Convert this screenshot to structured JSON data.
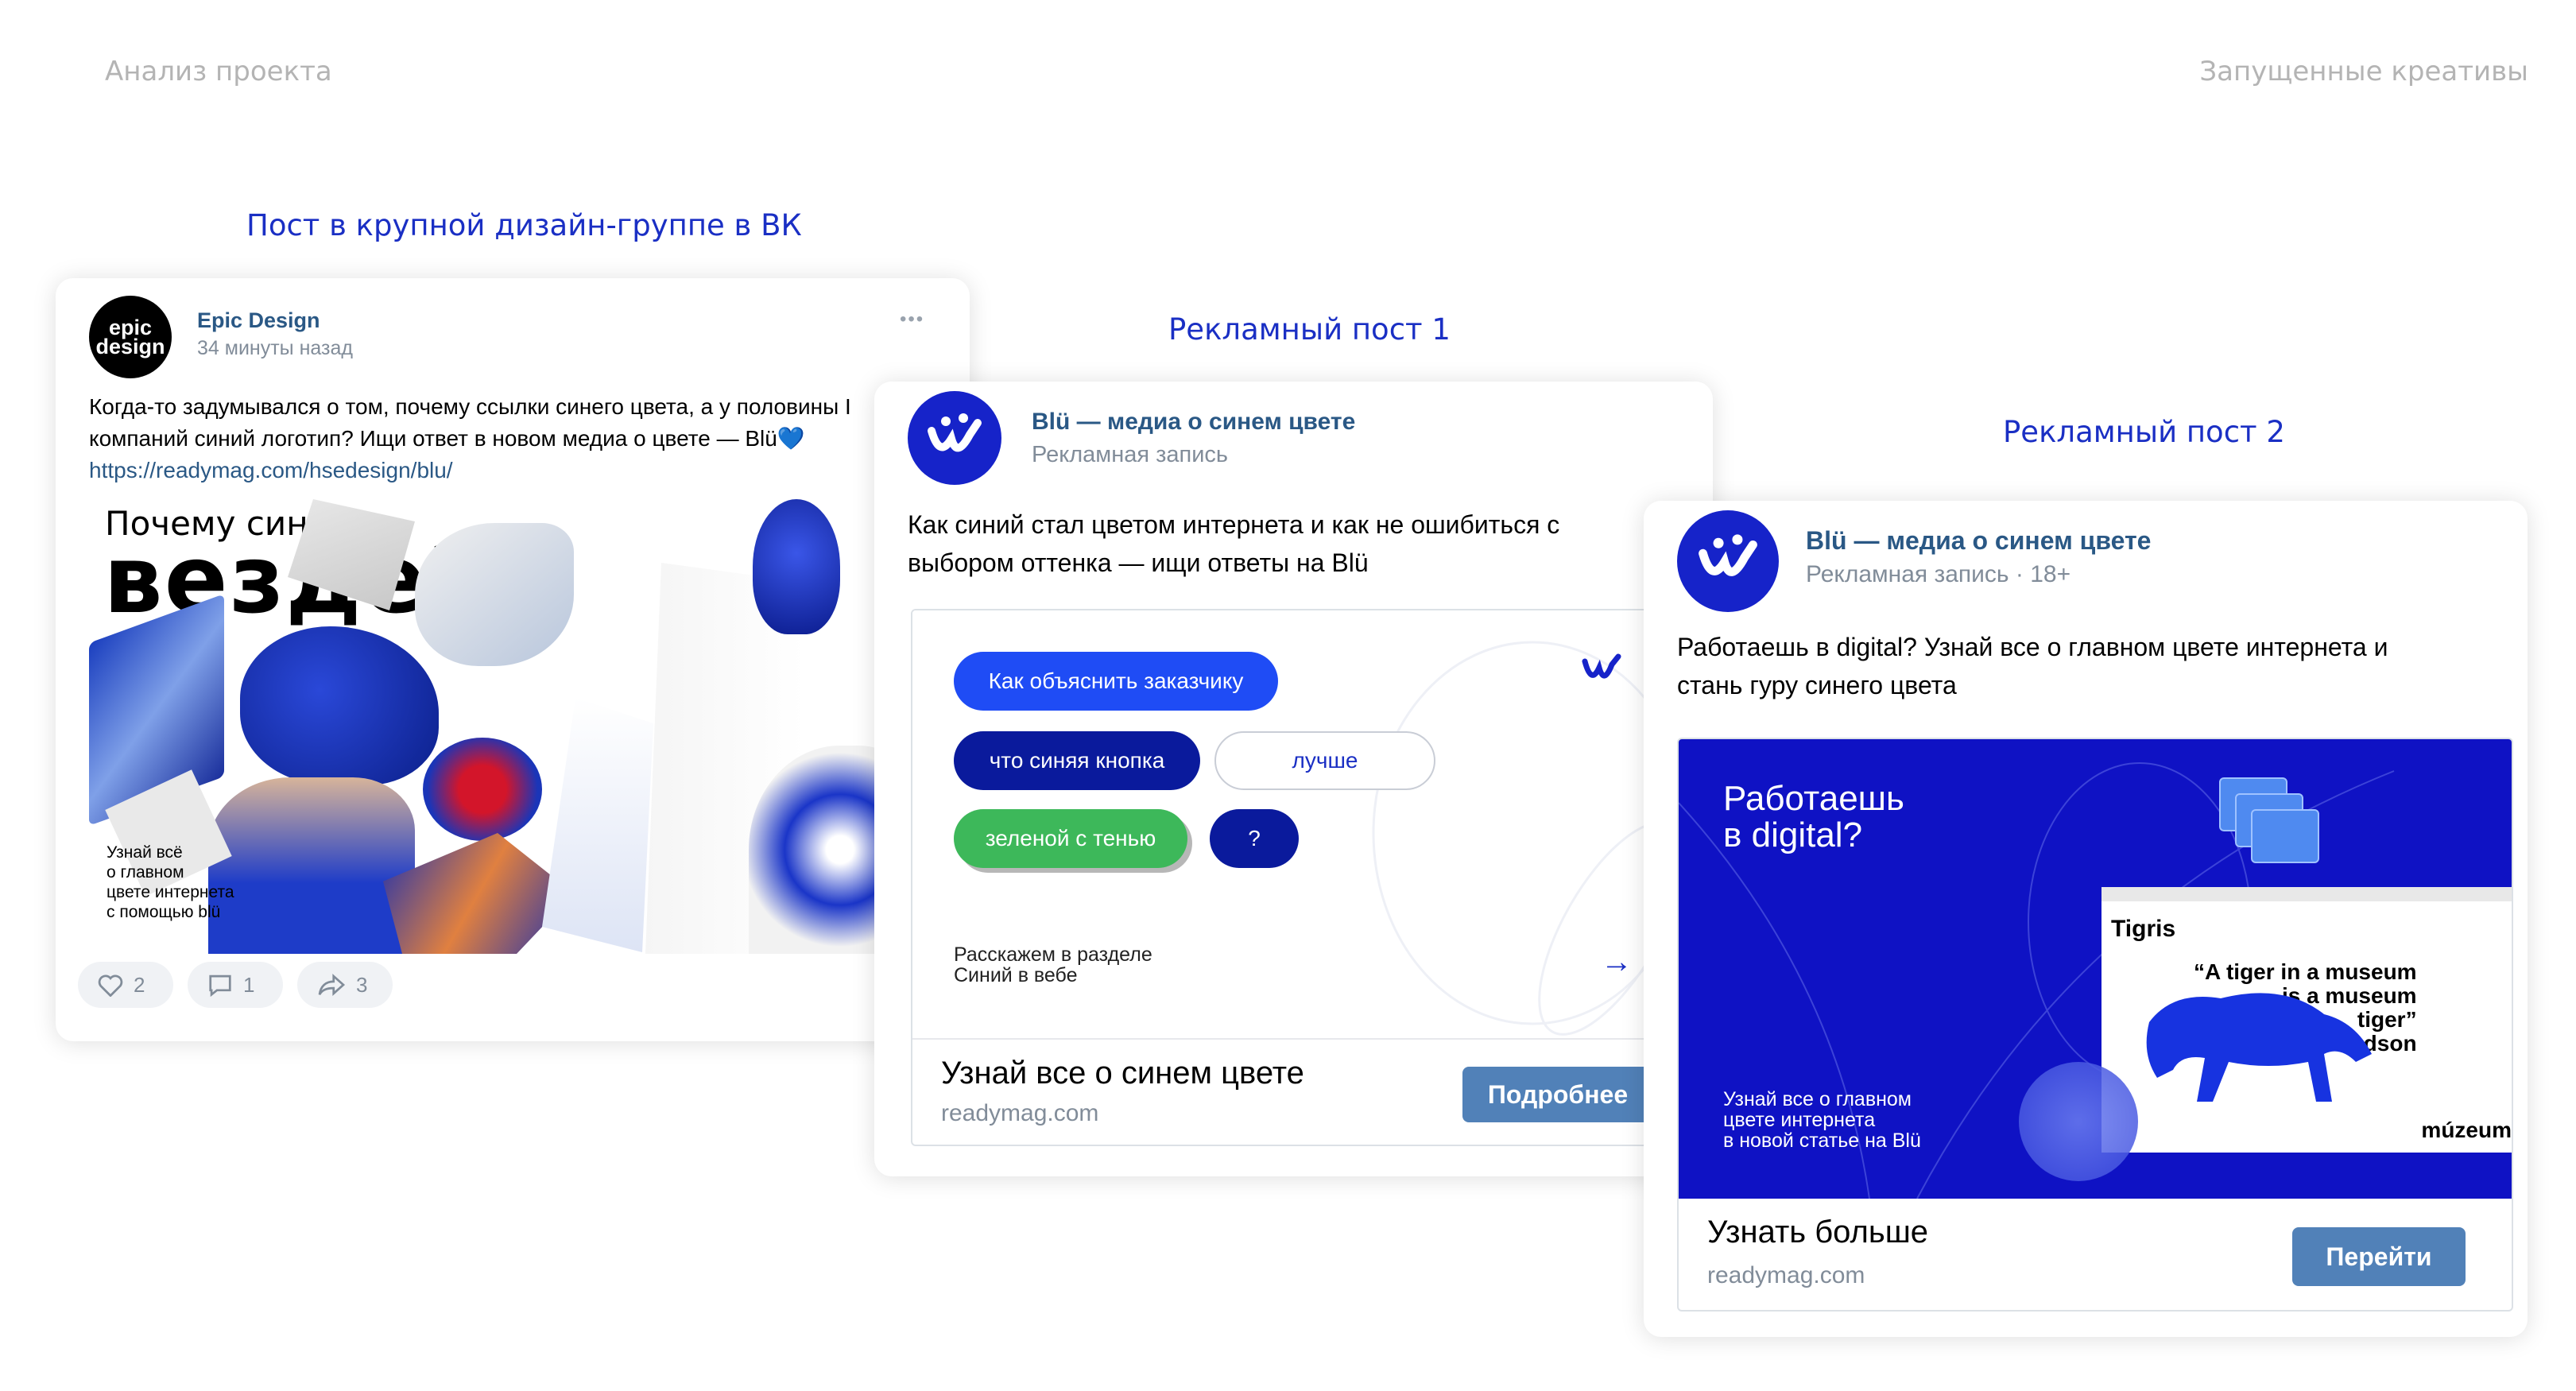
{
  "header": {
    "left": "Анализ проекта",
    "right": "Запущенные креативы"
  },
  "captions": {
    "post_vk": "Пост в крупной дизайн-группе в ВК",
    "ad1": "Рекламный пост 1",
    "ad2": "Рекламный пост 2"
  },
  "post": {
    "avatar_text_1": "epic",
    "avatar_text_2": "design",
    "author": "Epic Design",
    "time": "34 минуты назад",
    "menu": "•••",
    "text_line1": "Когда-то задумывался о том, почему ссылки синего цвета, а у половины I",
    "text_line2": "компаний синий логотип? Ищи ответ в новом медиа о цвете — Blü💙",
    "link": "https://readymag.com/hsedesign/blu/",
    "image": {
      "title_small": "Почему синий",
      "title_big": "везде?",
      "caption_1": "Узнай всё",
      "caption_2": "о главном",
      "caption_3": "цвете интернета",
      "caption_4": "с помощью blü"
    },
    "likes": "2",
    "comments": "1",
    "shares": "3"
  },
  "ad1": {
    "author": "Blü — медиа о синем цвете",
    "label": "Рекламная запись",
    "text_line1": "Как синий стал цветом интернета и как не ошибиться с",
    "text_line2": "выбором оттенка — ищи ответы на Blü",
    "pills": {
      "p1": "Как объяснить заказчику",
      "p2": "что синяя кнопка",
      "p3": "лучше",
      "p4": "зеленой с тенью",
      "p5": "?"
    },
    "note_1": "Расскажем в разделе",
    "note_2": "Синий в вебе",
    "arrow": "→",
    "title": "Узнай все о синем цвете",
    "domain": "readymag.com",
    "button": "Подробнее"
  },
  "ad2": {
    "author": "Blü — медиа о синем цвете",
    "label": "Рекламная запись · 18+",
    "text_line1": "Работаешь в digital? Узнай все о главном цвете интернета и",
    "text_line2": "стань гуру синего цвета",
    "banner": {
      "headline_1": "Работаешь",
      "headline_2": "в digital?",
      "small_1": "Узнай все о главном",
      "small_2": "цвете интернета",
      "small_3": "в новой статье на Blü",
      "window_title": "Tigris",
      "quote_1": "“A tiger in a museum",
      "quote_2": "is a museum",
      "quote_3": "tiger”",
      "quote_author": "Kenneth Hudson",
      "brand": "múzeum"
    },
    "title": "Узнать больше",
    "domain": "readymag.com",
    "button": "Перейти"
  },
  "colors": {
    "brand_blue": "#1623c9",
    "vk_link": "#2a5885",
    "vk_button": "#5181b8",
    "pill_blue": "#1f4cf5",
    "pill_navy": "#0a1a9c",
    "pill_green": "#3db85a",
    "caption_blue": "#1a2fc4"
  }
}
